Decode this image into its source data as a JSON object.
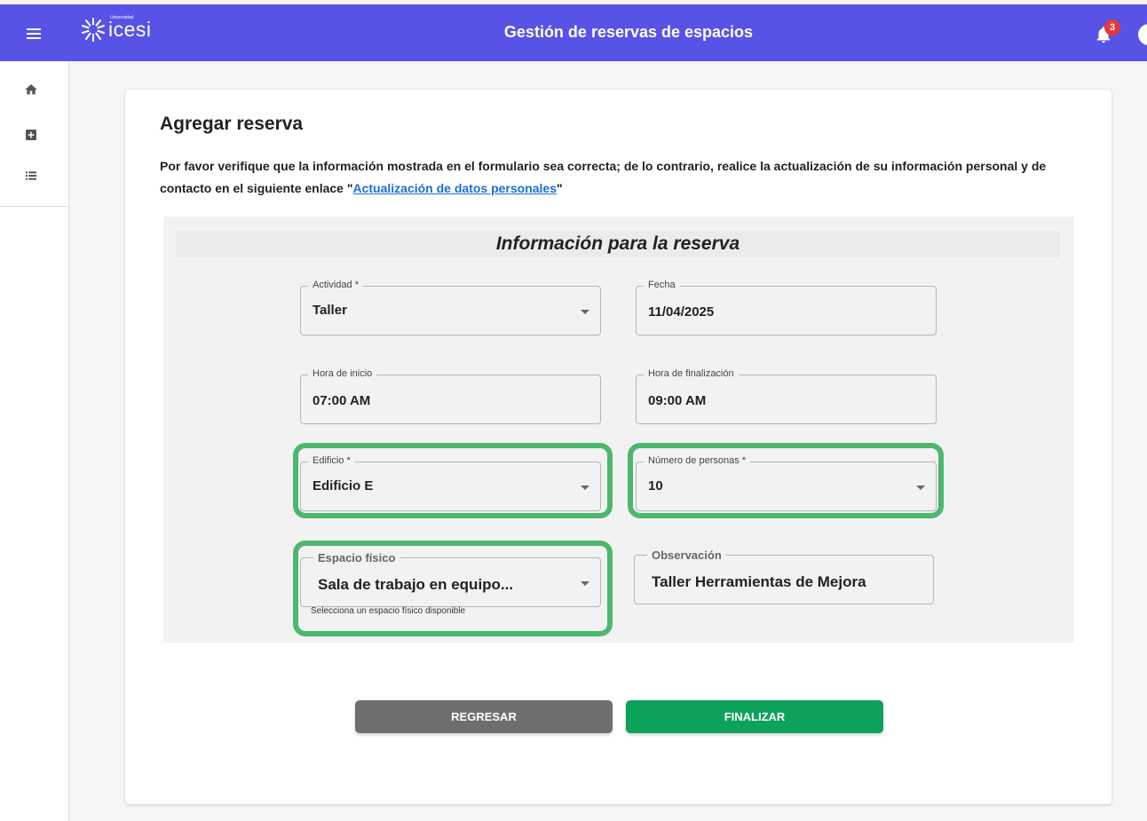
{
  "header": {
    "logo_small": "Universidad",
    "logo_text": "icesi",
    "title": "Gestión de reservas de espacios",
    "notification_count": "3",
    "icons": [
      "menu-icon",
      "bell-icon",
      "user-icon"
    ]
  },
  "sidebar": {
    "icons": [
      "home-icon",
      "add-box-icon",
      "list-icon"
    ]
  },
  "card": {
    "title": "Agregar reserva",
    "intro_text": "Por favor verifique que la información mostrada en el formulario sea correcta; de lo contrario, realice la actualización de su información personal y de contacto en el siguiente enlace \"",
    "link_text": "Actualización de datos personales",
    "intro_end": "\""
  },
  "form": {
    "section_title": "Información para la reserva",
    "actividad": {
      "label": "Actividad *",
      "value": "Taller"
    },
    "fecha": {
      "label": "Fecha",
      "value": "11/04/2025"
    },
    "hora_inicio": {
      "label": "Hora de inicio",
      "value": "07:00 AM"
    },
    "hora_fin": {
      "label": "Hora de finalización",
      "value": "09:00 AM"
    },
    "edificio": {
      "label": "Edificio *",
      "value": "Edificio E"
    },
    "personas": {
      "label": "Número de personas *",
      "value": "10"
    },
    "espacio": {
      "label": "Espacio físico",
      "value": "Sala de trabajo en equipo...",
      "hint": "Selecciona un espacio físico disponible"
    },
    "observacion": {
      "label": "Observación",
      "value": "Taller Herramientas de Mejora"
    }
  },
  "buttons": {
    "back": "REGRESAR",
    "finish": "FINALIZAR"
  },
  "colors": {
    "header": "#5753e6",
    "highlight": "#4cb86e",
    "finish": "#0ca25a",
    "back": "#6d6f6e",
    "link": "#1a6fd1"
  }
}
